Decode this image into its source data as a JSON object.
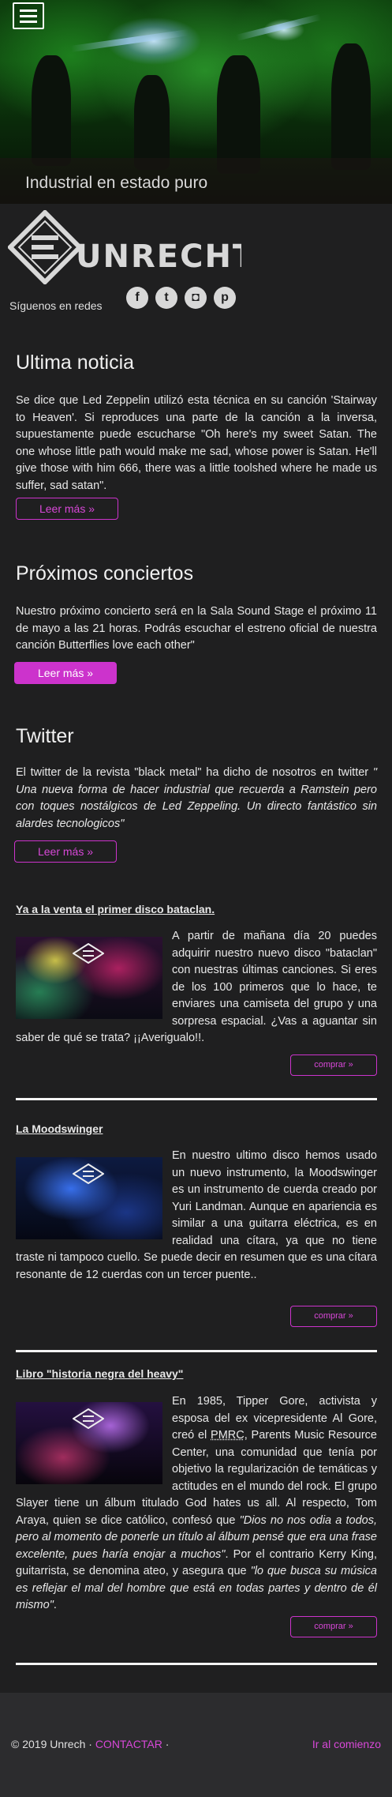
{
  "hero": {
    "title": "Industrial en estado puro"
  },
  "brand": {
    "name": "UNRECHT"
  },
  "social": {
    "label": "Síguenos en redes",
    "icons": [
      "facebook-icon",
      "twitter-icon",
      "instagram-icon",
      "pinterest-icon"
    ]
  },
  "news": {
    "title": "Ultima noticia",
    "text": "Se dice que Led Zeppelin utilizó esta técnica en su canción 'Stairway to Heaven'. Si reproduces una parte de la canción a la inversa, supuestamente puede escucharse \"Oh here's my sweet Satan. The one whose little path would make me sad, whose power is Satan. He'll give those with him 666, there was a little toolshed where he made us suffer, sad satan\".",
    "button": "Leer más »"
  },
  "concerts": {
    "title": "Próximos conciertos",
    "text": "Nuestro próximo concierto será en la Sala Sound Stage el próximo 11 de mayo a las 21 horas. Podrás escuchar el estreno oficial de nuestra canción Butterflies love each other\"",
    "button": "Leer más »"
  },
  "twitter": {
    "title": "Twitter",
    "text_plain": "El twitter de la revista \"black metal\" ha dicho de nosotros en twitter ",
    "text_quote": "\" Una nueva forma de hacer industrial que recuerda a Ramstein pero con toques nostálgicos de Led Zeppeling. Un directo fantástico sin alardes tecnologicos\"",
    "button": "Leer más »"
  },
  "articles": [
    {
      "title": "Ya a la venta el primer disco bataclan.",
      "text": "A partir de mañana día 20 puedes adquirir nuestro nuevo disco \"bataclan\" con nuestras últimas canciones. Si eres de los 100 primeros que lo hace, te enviares una camiseta del grupo y una sorpresa espacial. ¿Vas a aguantar sin saber de qué se trata? ¡¡Averigualo!!.",
      "button": "comprar »"
    },
    {
      "title": "La Moodswinger",
      "text": "En nuestro ultimo disco hemos usado un nuevo instrumento, la Moodswinger es un instrumento de cuerda creado por Yuri Landman. Aunque en apariencia es similar a una guitarra eléctrica, es en realidad una cítara, ya que no tiene traste ni tampoco cuello. Se puede decir en resumen que es una cítara resonante de 12 cuerdas con un tercer puente..",
      "button": "comprar »"
    },
    {
      "title": "Libro \"historia negra del heavy\"",
      "text_1": "En 1985, Tipper Gore, activista y esposa del ex vicepresidente Al Gore, creó el ",
      "abbr": "PMRC",
      "text_2": ", Parents Music Resource Center, una comunidad que tenía por objetivo la regularización de temáticas y actitudes en el mundo del rock. El grupo Slayer tiene un álbum titulado God hates us all. Al respecto, Tom Araya, quien se dice católico, confesó que ",
      "quote_1": "\"Dios no nos odia a todos, pero al momento de ponerle un título al álbum pensé que era una frase excelente, pues haría enojar a muchos\"",
      "text_3": ". Por el contrario Kerry King, guitarrista, se denomina ateo, y asegura que ",
      "quote_2": "\"lo que busca su música es reflejar el mal del hombre que está en todas partes y dentro de él mismo\"",
      "text_4": ".",
      "button": "comprar »"
    }
  ],
  "footer": {
    "copyright": "© 2019 Unrech · ",
    "contact": "CONTACTAR",
    "separator": " ·",
    "top_link": "Ir al comienzo"
  },
  "colors": {
    "accent": "#cc33cc",
    "background": "#1f1f20",
    "footer": "#2c2c2e"
  }
}
